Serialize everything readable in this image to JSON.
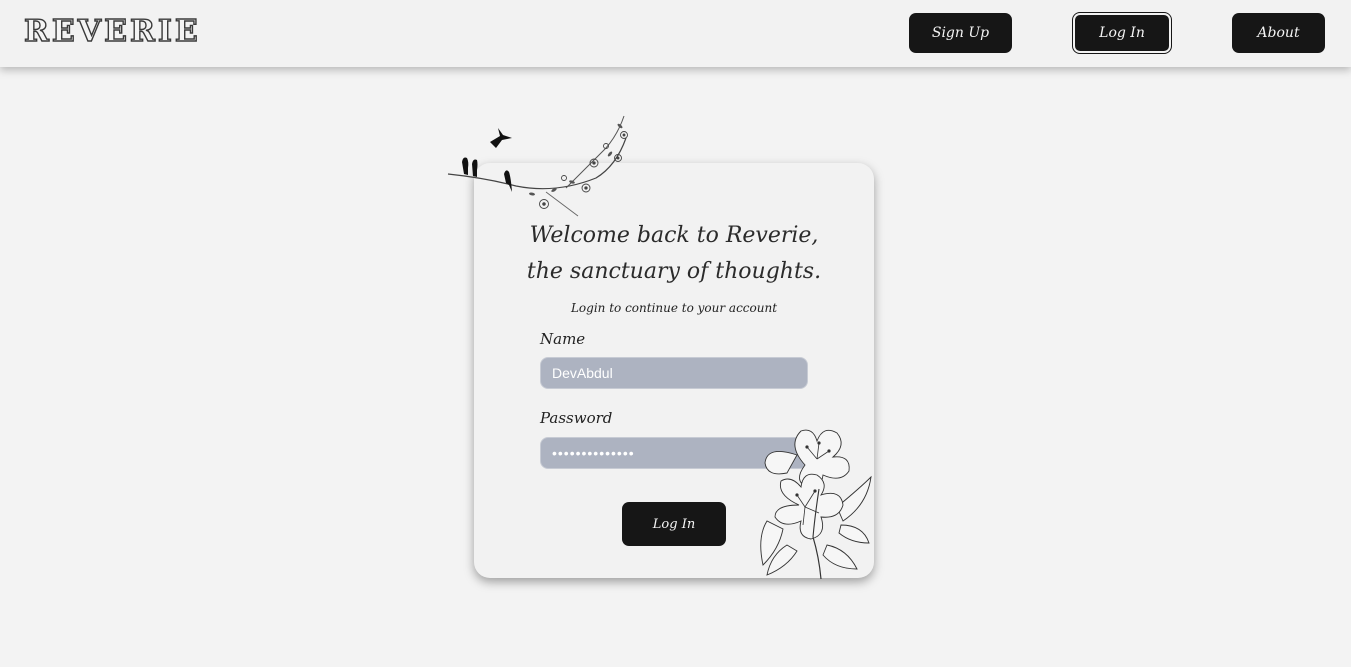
{
  "header": {
    "logo": "REVERIE",
    "nav": {
      "signup_label": "Sign Up",
      "login_label": "Log In",
      "about_label": "About"
    }
  },
  "login_card": {
    "welcome_line1": "Welcome back to Reverie,",
    "welcome_line2": "the sanctuary of thoughts.",
    "subtitle": "Login to continue to your account",
    "name_label": "Name",
    "name_value": "DevAbdul",
    "password_label": "Password",
    "password_value": "••••••••••••••",
    "submit_label": "Log In"
  },
  "decorations": {
    "top_left": "birds-on-branch-icon",
    "bottom_right": "hibiscus-flower-icon"
  },
  "colors": {
    "background": "#f3f3f3",
    "button": "#161616",
    "input_fill": "#adb3c1"
  }
}
